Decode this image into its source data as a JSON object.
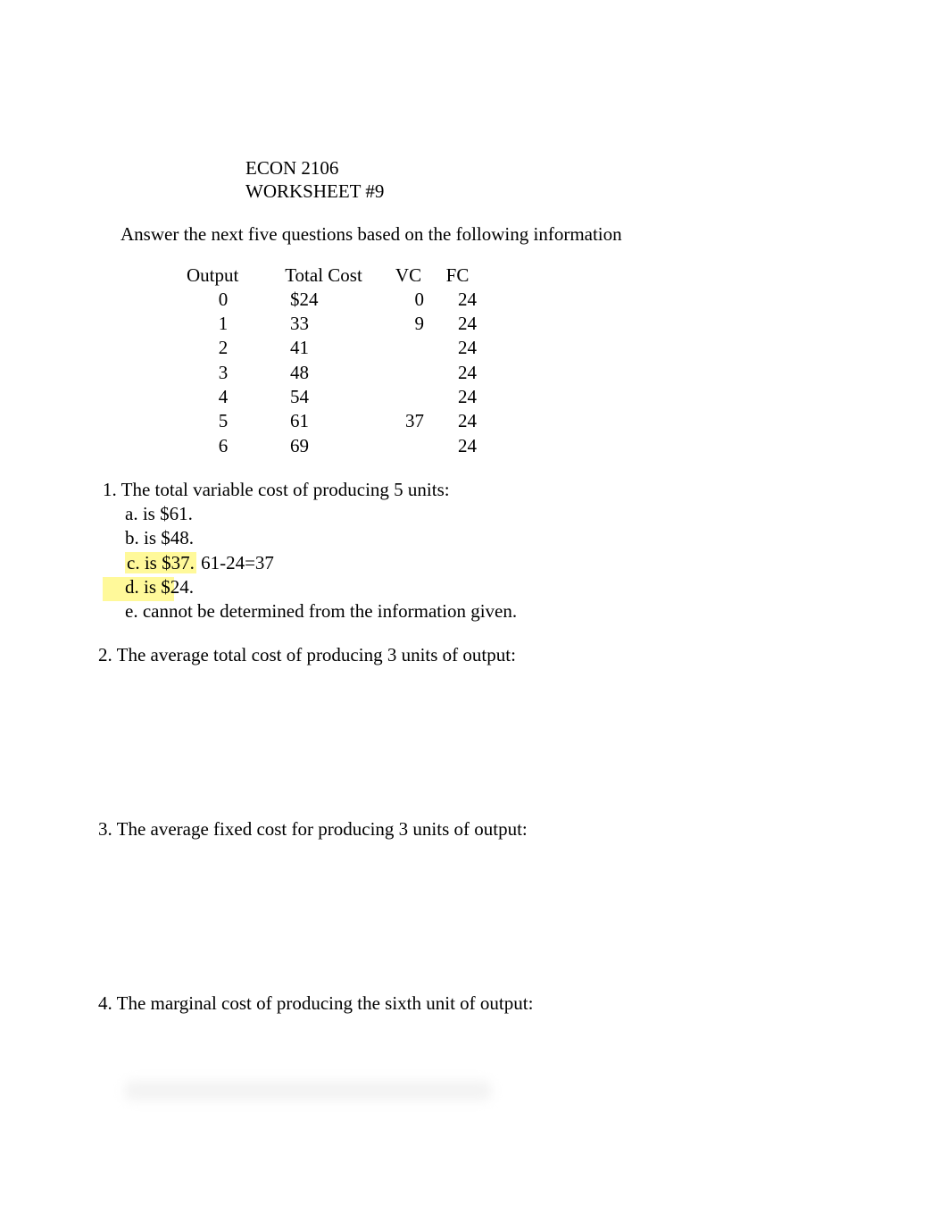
{
  "header": {
    "course": "ECON 2106",
    "worksheet": "WORKSHEET #9"
  },
  "intro": "Answer the next five questions based on the following information",
  "table": {
    "headers": {
      "output": "Output",
      "tc": "Total Cost",
      "vc": "VC",
      "fc": "FC"
    },
    "rows": [
      {
        "output": "0",
        "tc": "$24",
        "vc": "0",
        "fc": "24"
      },
      {
        "output": "1",
        "tc": "33",
        "vc": "9",
        "fc": "24"
      },
      {
        "output": "2",
        "tc": "41",
        "vc": "",
        "fc": "24"
      },
      {
        "output": "3",
        "tc": "48",
        "vc": "",
        "fc": "24"
      },
      {
        "output": "4",
        "tc": "54",
        "vc": "",
        "fc": "24"
      },
      {
        "output": "5",
        "tc": "61",
        "vc": "37",
        "fc": "24"
      },
      {
        "output": "6",
        "tc": "69",
        "vc": "",
        "fc": "24"
      }
    ]
  },
  "q1": {
    "number": " 1.",
    "stem": "  The total variable cost of producing 5 units:",
    "a": "a.  is $61.",
    "b": "b.  is $48.",
    "c": "c.  is $37.",
    "c_extra": "   61-24=37",
    "d": "d.  is $24.",
    "e": "e.  cannot be determined from the information given."
  },
  "q2": {
    "number": "2.",
    "stem": "  The average total cost of producing 3 units of output:"
  },
  "q3": {
    "number": "3.",
    "stem": "  The average fixed cost for producing 3 units of output:"
  },
  "q4": {
    "number": "4.",
    "stem": "  The marginal cost of producing the sixth unit of output:"
  }
}
